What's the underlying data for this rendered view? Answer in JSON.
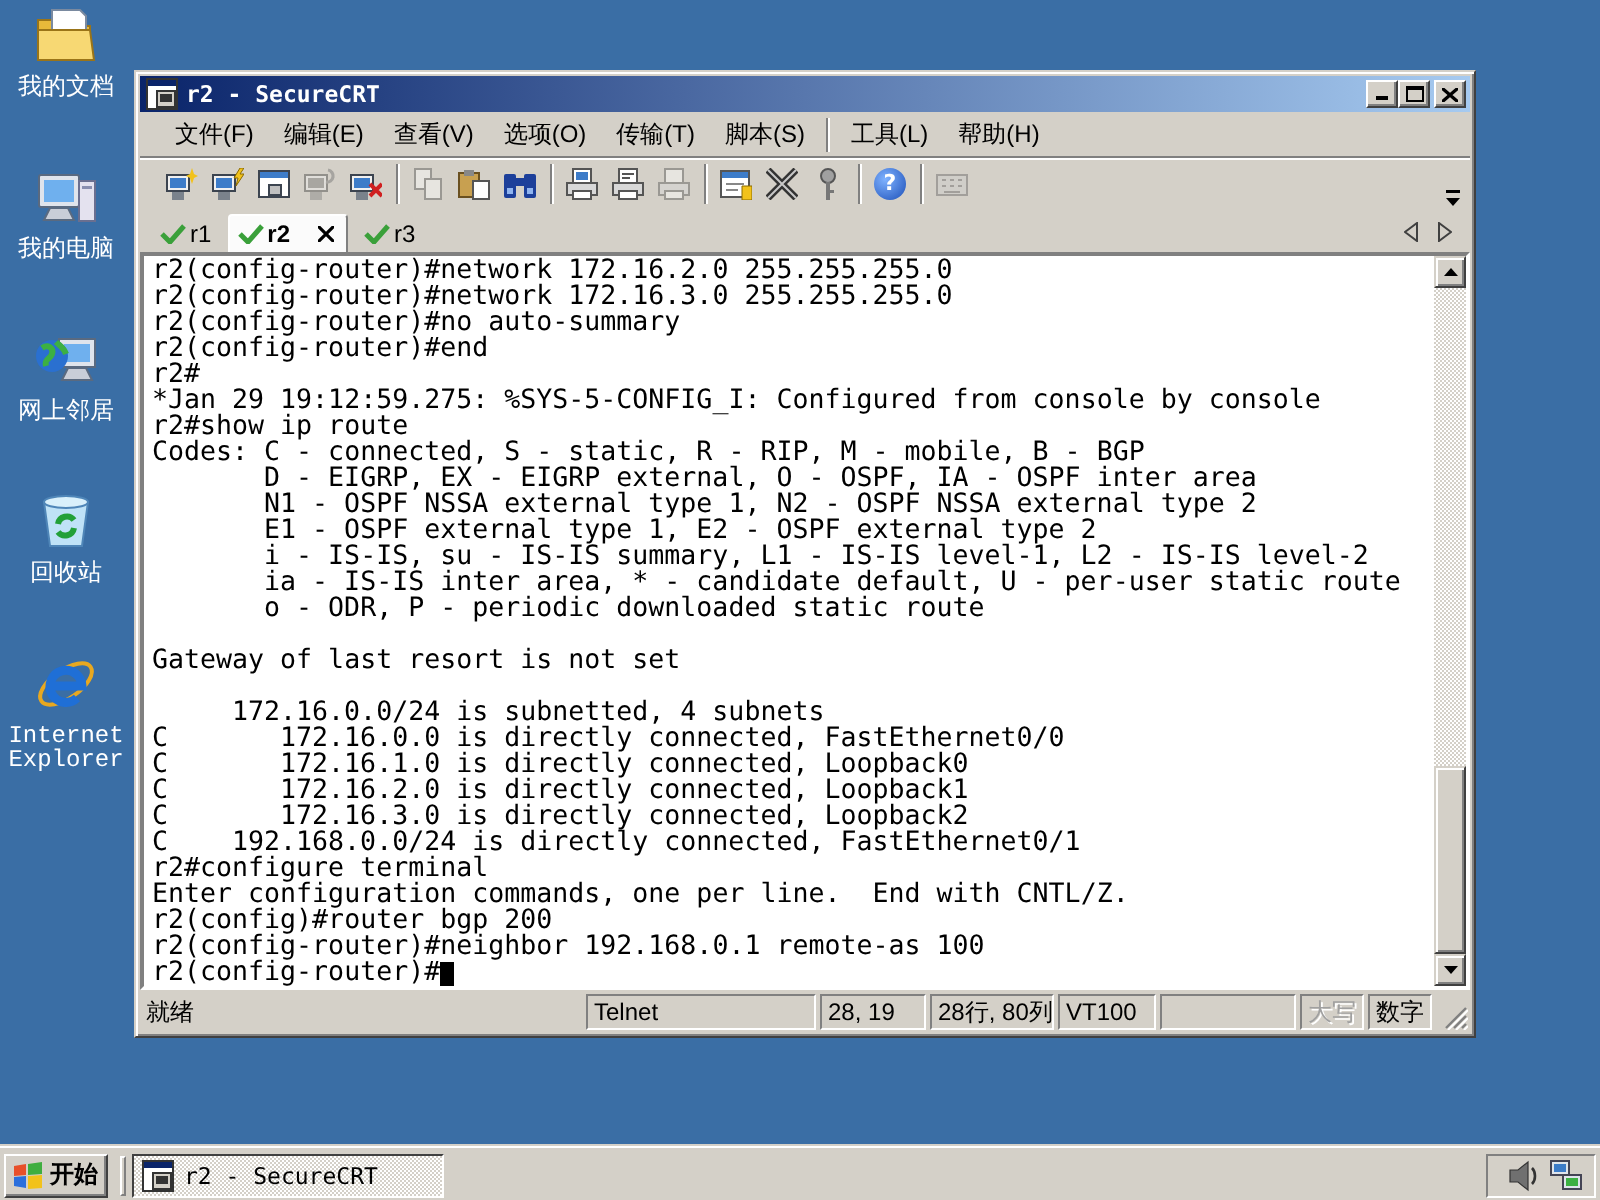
{
  "desktop_icons": [
    {
      "kind": "documents",
      "label": "我的文档"
    },
    {
      "kind": "computer",
      "label": "我的电脑"
    },
    {
      "kind": "network",
      "label": "网上邻居"
    },
    {
      "kind": "recycle-bin",
      "label": "回收站"
    },
    {
      "kind": "browser",
      "label": "Internet Explorer"
    }
  ],
  "window": {
    "title": "r2 - SecureCRT",
    "active": true
  },
  "menu": [
    {
      "items": [
        "文件(F)",
        "编辑(E)",
        "查看(V)",
        "选项(O)",
        "传输(T)",
        "脚本(S)"
      ]
    },
    {
      "items": [
        "工具(L)",
        "帮助(H)"
      ]
    }
  ],
  "toolbar": [
    {
      "buttons": [
        {
          "kind": "quick-connect",
          "disabled": false
        },
        {
          "kind": "connect",
          "disabled": false
        },
        {
          "kind": "connect-tab",
          "disabled": false
        },
        {
          "kind": "reconnect",
          "disabled": true
        },
        {
          "kind": "disconnect",
          "disabled": false
        }
      ]
    },
    {
      "buttons": [
        {
          "kind": "copy",
          "disabled": true
        },
        {
          "kind": "paste",
          "disabled": false
        },
        {
          "kind": "find",
          "disabled": false
        }
      ]
    },
    {
      "buttons": [
        {
          "kind": "print-screen",
          "disabled": false
        },
        {
          "kind": "print-selection",
          "disabled": false
        },
        {
          "kind": "print",
          "disabled": true
        }
      ]
    },
    {
      "buttons": [
        {
          "kind": "session-options",
          "disabled": false
        },
        {
          "kind": "global-options",
          "disabled": false
        },
        {
          "kind": "key",
          "disabled": false
        }
      ]
    },
    {
      "buttons": [
        {
          "kind": "help",
          "disabled": false,
          "symbol": "?"
        }
      ]
    },
    {
      "buttons": [
        {
          "kind": "keymap",
          "disabled": true
        }
      ]
    }
  ],
  "tabs": [
    {
      "label": "r1",
      "selected": false,
      "connected": true
    },
    {
      "label": "r2",
      "selected": true,
      "connected": true
    },
    {
      "label": "r3",
      "selected": false,
      "connected": true
    }
  ],
  "terminal": {
    "sections": [
      {
        "blocks": [
          {
            "kind": "lines",
            "lines": [
              "r2(config-router)#network 172.16.2.0 255.255.255.0",
              "r2(config-router)#network 172.16.3.0 255.255.255.0",
              "r2(config-router)#no auto-summary",
              "r2(config-router)#end",
              "r2#",
              "*Jan 29 19:12:59.275: %SYS-5-CONFIG_I: Configured from console by console",
              "r2#show ip route"
            ]
          },
          {
            "kind": "codes",
            "lines": [
              "Codes: C - connected, S - static, R - RIP, M - mobile, B - BGP",
              "D - EIGRP, EX - EIGRP external, O - OSPF, IA - OSPF inter area",
              "N1 - OSPF NSSA external type 1, N2 - OSPF NSSA external type 2",
              "E1 - OSPF external type 1, E2 - OSPF external type 2",
              "i - IS-IS, su - IS-IS summary, L1 - IS-IS level-1, L2 - IS-IS level-2",
              "ia - IS-IS inter area, * - candidate default, U - per-user static route",
              "o - ODR, P - periodic downloaded static route"
            ]
          }
        ]
      },
      {
        "blocks": [
          {
            "kind": "lines",
            "lines": [
              "Gateway of last resort is not set"
            ]
          }
        ]
      },
      {
        "blocks": [
          {
            "kind": "routes",
            "routes": [
              {
                "text": "172.16.0.0/24 is subnetted, 4 subnets",
                "children": [
                  {
                    "code": "C",
                    "text": "172.16.0.0 is directly connected, FastEthernet0/0"
                  },
                  {
                    "code": "C",
                    "text": "172.16.1.0 is directly connected, Loopback0"
                  },
                  {
                    "code": "C",
                    "text": "172.16.2.0 is directly connected, Loopback1"
                  },
                  {
                    "code": "C",
                    "text": "172.16.3.0 is directly connected, Loopback2"
                  }
                ]
              },
              {
                "code": "C",
                "text": "192.168.0.0/24 is directly connected, FastEthernet0/1"
              }
            ]
          },
          {
            "kind": "lines",
            "lines": [
              "r2#configure terminal",
              "Enter configuration commands, one per line.  End with CNTL/Z.",
              "r2(config)#router bgp 200",
              "r2(config-router)#neighbor 192.168.0.1 remote-as 100"
            ]
          },
          {
            "kind": "prompt",
            "text": "r2(config-router)#"
          }
        ]
      }
    ]
  },
  "status_bar": {
    "message": "就绪",
    "panels": [
      "Telnet",
      "28, 19",
      "28行, 80列",
      "VT100"
    ],
    "indicators": [
      {
        "label": "大写",
        "on": false
      },
      {
        "label": "数字",
        "on": true
      }
    ]
  },
  "taskbar": {
    "start": "开始",
    "tasks": [
      {
        "label": "r2 - SecureCRT",
        "selected": true
      }
    ]
  }
}
